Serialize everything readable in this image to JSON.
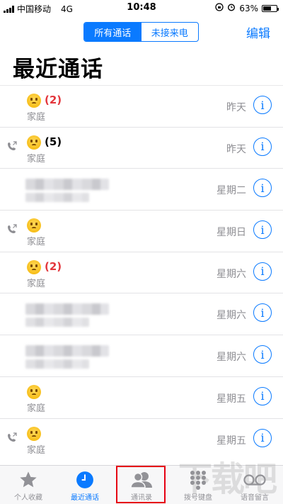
{
  "status_bar": {
    "carrier": "中国移动",
    "network": "4G",
    "time": "10:48",
    "battery": "63%",
    "battery_level": 0.63
  },
  "nav": {
    "segment_all": "所有通话",
    "segment_missed": "未接来电",
    "edit": "编辑",
    "title": "最近通话"
  },
  "calls": [
    {
      "count": "(2)",
      "missed": true,
      "outgoing": false,
      "label": "家庭",
      "date": "昨天"
    },
    {
      "count": "(5)",
      "missed": false,
      "outgoing": true,
      "label": "家庭",
      "date": "昨天"
    },
    {
      "redacted": true,
      "date": "星期二"
    },
    {
      "count": "",
      "missed": false,
      "outgoing": true,
      "label": "家庭",
      "date": "星期日"
    },
    {
      "count": "(2)",
      "missed": true,
      "outgoing": false,
      "label": "家庭",
      "date": "星期六"
    },
    {
      "redacted": true,
      "date": "星期六"
    },
    {
      "redacted": true,
      "date": "星期六"
    },
    {
      "count": "",
      "missed": false,
      "outgoing": false,
      "label": "家庭",
      "date": "星期五"
    },
    {
      "count": "",
      "missed": false,
      "outgoing": true,
      "label": "家庭",
      "date": "星期五"
    }
  ],
  "info_symbol": "i",
  "tabs": [
    {
      "label": "个人收藏",
      "icon": "star-icon"
    },
    {
      "label": "最近通话",
      "icon": "clock-icon",
      "active": true
    },
    {
      "label": "通讯录",
      "icon": "contacts-icon"
    },
    {
      "label": "拨号键盘",
      "icon": "keypad-icon"
    },
    {
      "label": "语音留言",
      "icon": "voicemail-icon"
    }
  ],
  "colors": {
    "accent": "#0a7aff",
    "missed": "#e3363c",
    "highlight": "#e60012"
  }
}
